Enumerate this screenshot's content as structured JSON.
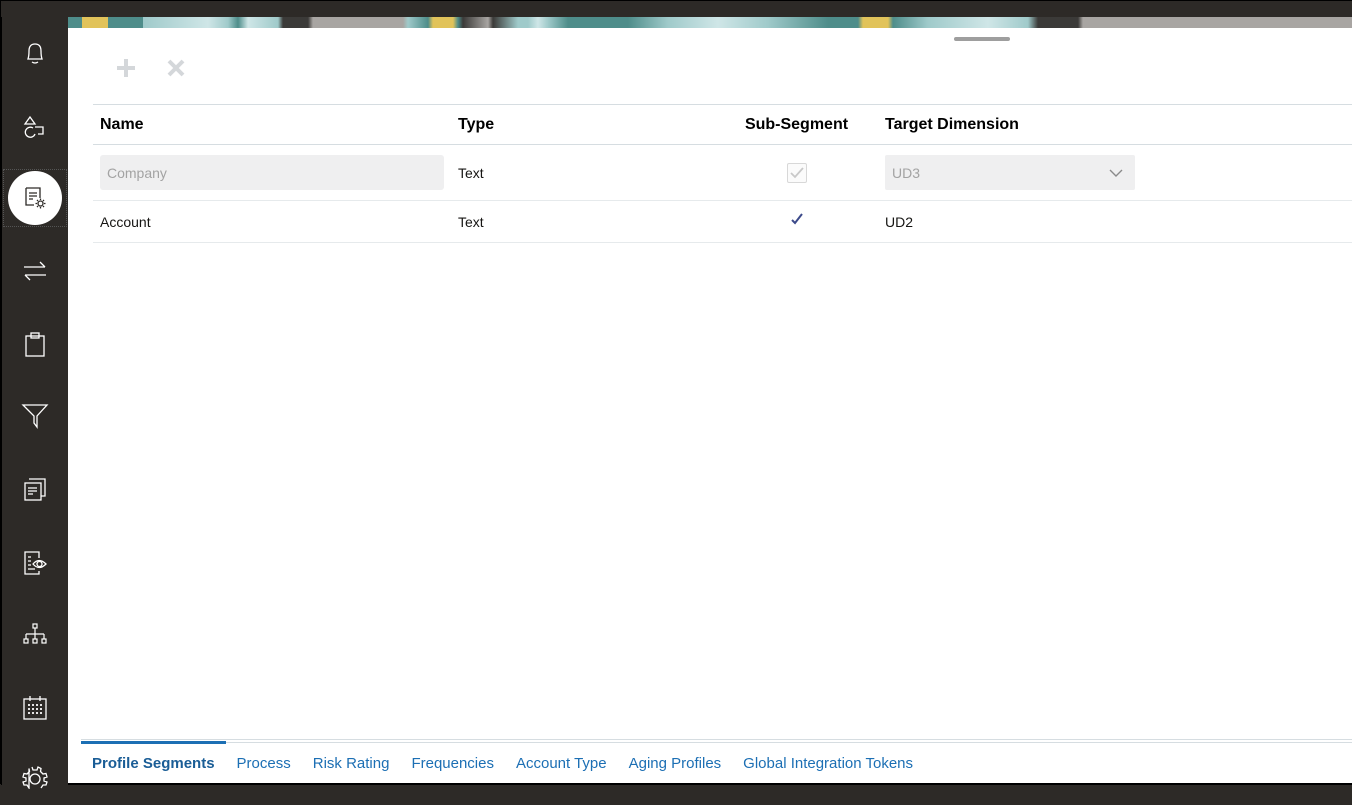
{
  "sidebar": {
    "items": [
      {
        "name": "notifications",
        "icon": "bell-icon"
      },
      {
        "name": "tasks",
        "icon": "shapes-icon"
      },
      {
        "name": "application-settings",
        "icon": "document-gear-icon",
        "active": true
      },
      {
        "name": "transfer",
        "icon": "arrows-exchange-icon"
      },
      {
        "name": "clipboard",
        "icon": "clipboard-icon"
      },
      {
        "name": "filters",
        "icon": "filter-icon"
      },
      {
        "name": "documents",
        "icon": "documents-icon"
      },
      {
        "name": "review",
        "icon": "document-eye-icon"
      },
      {
        "name": "hierarchy",
        "icon": "hierarchy-icon"
      },
      {
        "name": "calendar",
        "icon": "calendar-icon"
      },
      {
        "name": "settings",
        "icon": "gear-icon"
      }
    ]
  },
  "toolbar": {
    "add_icon": "plus-icon",
    "delete_icon": "close-icon"
  },
  "table": {
    "columns": [
      "Name",
      "Type",
      "Sub-Segment",
      "Target Dimension"
    ],
    "rows": [
      {
        "name": "Company",
        "type": "Text",
        "sub_segment": true,
        "target_dimension": "UD3",
        "editing": true
      },
      {
        "name": "Account",
        "type": "Text",
        "sub_segment": true,
        "target_dimension": "UD2",
        "editing": false
      }
    ]
  },
  "tabs": [
    {
      "label": "Profile Segments",
      "active": true
    },
    {
      "label": "Process"
    },
    {
      "label": "Risk Rating"
    },
    {
      "label": "Frequencies"
    },
    {
      "label": "Account Type"
    },
    {
      "label": "Aging Profiles"
    },
    {
      "label": "Global Integration Tokens"
    }
  ],
  "colors": {
    "accent": "#1c6fb4",
    "sidebar_bg": "#2d2a27",
    "check": "#3c4a8a"
  }
}
